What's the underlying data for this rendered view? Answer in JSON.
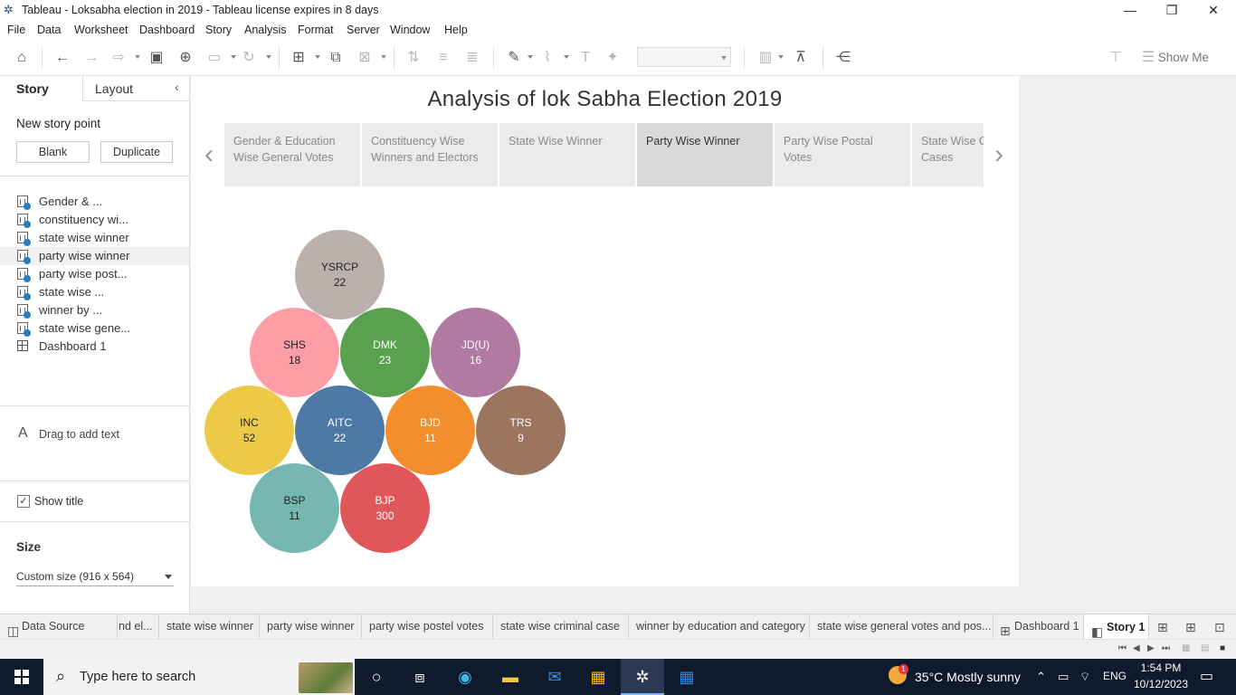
{
  "window": {
    "title": "Tableau - Loksabha election in 2019 - Tableau license expires in 8 days",
    "minimize": "—",
    "maximize": "❐",
    "close": "✕"
  },
  "menu": [
    "File",
    "Data",
    "Worksheet",
    "Dashboard",
    "Story",
    "Analysis",
    "Format",
    "Server",
    "Window",
    "Help"
  ],
  "toolbar": {
    "show_me": "Show Me"
  },
  "left_panel": {
    "tab_story": "Story",
    "tab_layout": "Layout",
    "new_story_point": "New story point",
    "blank_button": "Blank",
    "duplicate_button": "Duplicate",
    "sheets": [
      {
        "label": "Gender & ...",
        "type": "sheet"
      },
      {
        "label": "constituency wi...",
        "type": "sheet"
      },
      {
        "label": "state wise winner",
        "type": "sheet"
      },
      {
        "label": "party wise winner",
        "type": "sheet",
        "selected": true
      },
      {
        "label": "party wise post...",
        "type": "sheet"
      },
      {
        "label": "state wise ...",
        "type": "sheet"
      },
      {
        "label": "winner by ...",
        "type": "sheet"
      },
      {
        "label": "state wise gene...",
        "type": "sheet"
      },
      {
        "label": "Dashboard 1",
        "type": "dashboard"
      }
    ],
    "drag_text": "Drag to add text",
    "show_title_label": "Show title",
    "show_title_checked": true,
    "size_title": "Size",
    "size_value": "Custom size (916 x 564)"
  },
  "story": {
    "title": "Analysis of lok Sabha Election 2019",
    "points": [
      {
        "label": "Gender & Education Wise General Votes",
        "active": false
      },
      {
        "label": "Constituency Wise Winners and Electors",
        "active": false
      },
      {
        "label": "State Wise Winner",
        "active": false
      },
      {
        "label": "Party Wise Winner",
        "active": true
      },
      {
        "label": "Party Wise Postal Votes",
        "active": false
      },
      {
        "label": "State Wise Criminal Cases",
        "active": false
      }
    ]
  },
  "chart_data": {
    "type": "packed-bubble",
    "series": [
      {
        "name": "YSRCP",
        "value": 22,
        "color": "#bab0ac"
      },
      {
        "name": "SHS",
        "value": 18,
        "color": "#ff9da7"
      },
      {
        "name": "DMK",
        "value": 23,
        "color": "#59a14f"
      },
      {
        "name": "JD(U)",
        "value": 16,
        "color": "#b07aa1"
      },
      {
        "name": "INC",
        "value": 52,
        "color": "#edc948"
      },
      {
        "name": "AITC",
        "value": 22,
        "color": "#4e79a7"
      },
      {
        "name": "BJD",
        "value": 11,
        "color": "#f28e2b"
      },
      {
        "name": "TRS",
        "value": 9,
        "color": "#9c755f"
      },
      {
        "name": "BSP",
        "value": 11,
        "color": "#76b7b2"
      },
      {
        "name": "BJP",
        "value": 300,
        "color": "#e15759"
      }
    ]
  },
  "bottom_tabs": [
    {
      "label": "Data Source",
      "icon": "database-icon"
    },
    {
      "label": "nd el...",
      "icon": ""
    },
    {
      "label": "state wise winner",
      "icon": ""
    },
    {
      "label": "party wise winner",
      "icon": ""
    },
    {
      "label": "party wise postel votes",
      "icon": ""
    },
    {
      "label": "state wise criminal case",
      "icon": ""
    },
    {
      "label": "winner by education and category",
      "icon": ""
    },
    {
      "label": "state wise general votes and pos...",
      "icon": ""
    },
    {
      "label": "Dashboard 1",
      "icon": "dashboard-icon"
    },
    {
      "label": "Story 1",
      "icon": "story-icon",
      "active": true
    }
  ],
  "taskbar": {
    "search_placeholder": "Type here to search",
    "weather": "35°C  Mostly sunny",
    "language": "ENG",
    "time": "1:54 PM",
    "date": "10/12/2023",
    "weather_badge": "1"
  }
}
